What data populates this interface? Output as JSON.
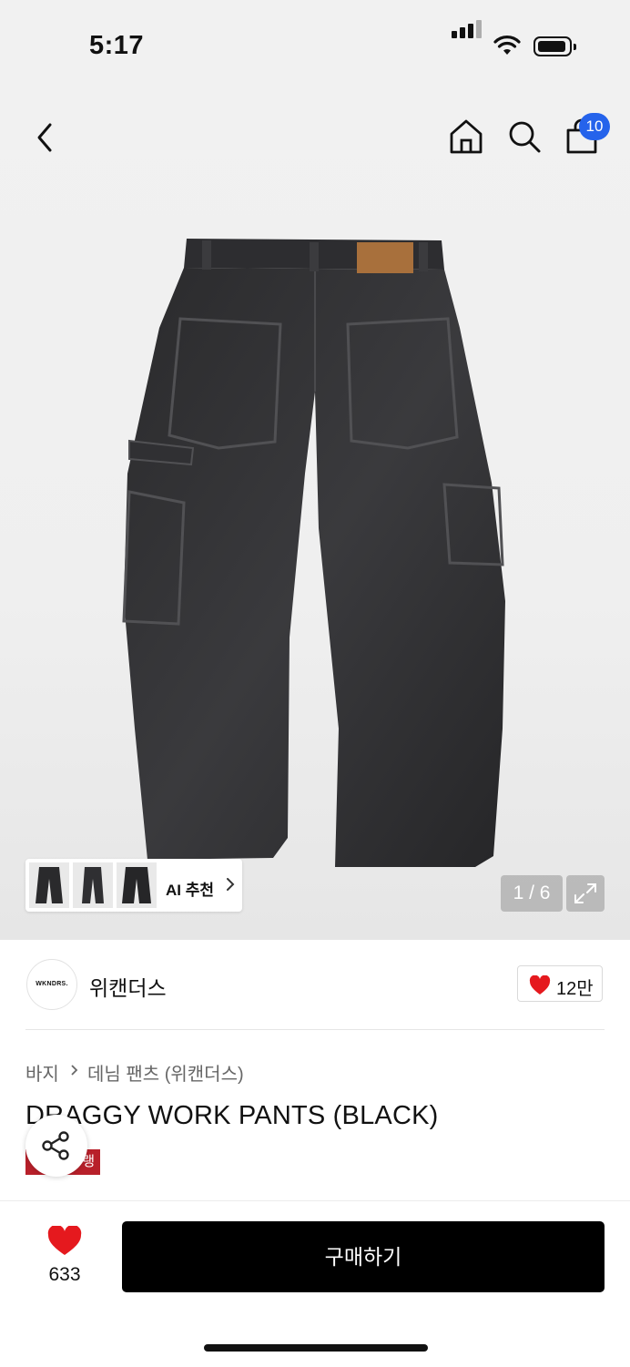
{
  "status_bar": {
    "time": "5:17"
  },
  "header": {
    "cart_count": "10"
  },
  "gallery": {
    "ai_label": "AI 추천",
    "counter": "1 / 6"
  },
  "brand": {
    "logo_text": "WKNDRS.",
    "name": "위캔더스",
    "likes": "12만"
  },
  "breadcrumb": {
    "category": "바지",
    "subcategory": "데님 팬츠 (위캔더스)"
  },
  "product": {
    "title": "DRAGGY WORK PANTS (BLACK)",
    "tag_text": "랭"
  },
  "bottom_bar": {
    "like_count": "633",
    "buy_label": "구매하기"
  },
  "colors": {
    "badge": "#2563eb",
    "heart": "#e5191e",
    "tag": "#b8202a",
    "buy_button": "#000000"
  },
  "icons": [
    "back-icon",
    "home-icon",
    "search-icon",
    "shopping-bag-icon",
    "chevron-right-icon",
    "expand-icon",
    "heart-icon",
    "share-icon"
  ]
}
